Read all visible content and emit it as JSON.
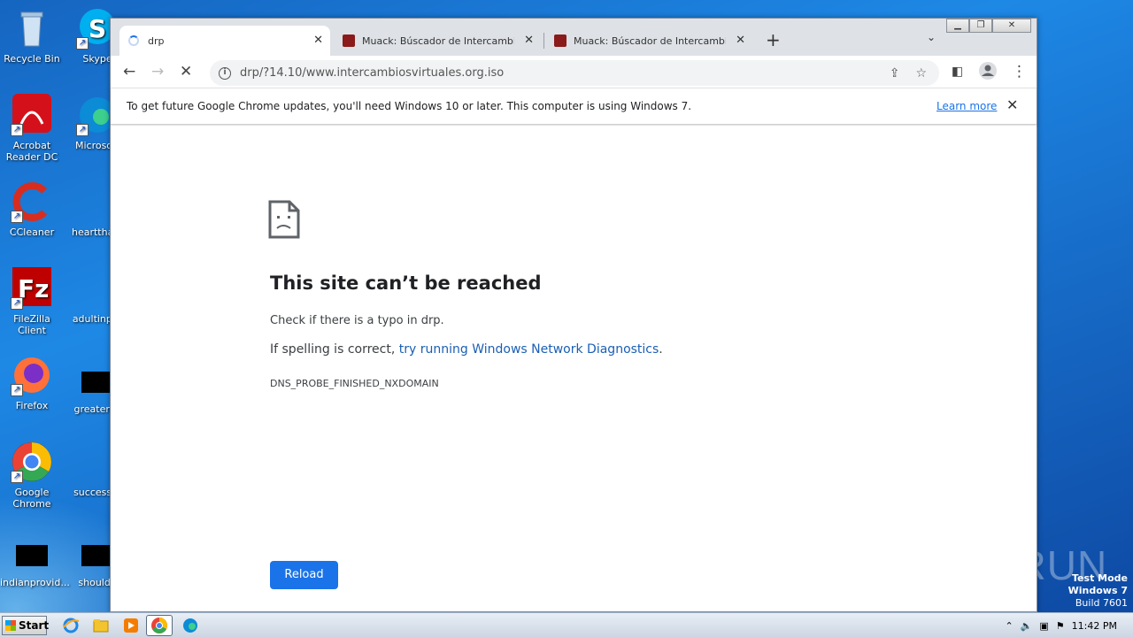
{
  "desktop": {
    "icons_col1": [
      {
        "label": "Recycle Bin",
        "icon": "recycle-bin-icon"
      },
      {
        "label": "Acrobat Reader DC",
        "icon": "acrobat-icon"
      },
      {
        "label": "CCleaner",
        "icon": "ccleaner-icon"
      },
      {
        "label": "FileZilla Client",
        "icon": "filezilla-icon"
      },
      {
        "label": "Firefox",
        "icon": "firefox-icon"
      },
      {
        "label": "Google Chrome",
        "icon": "chrome-icon"
      },
      {
        "label": "indianprovid...",
        "icon": "file-icon"
      }
    ],
    "icons_col2": [
      {
        "label": "Skype",
        "icon": "skype-icon"
      },
      {
        "label": "Microsoft",
        "icon": "edge-icon"
      },
      {
        "label": "hearttham",
        "icon": "file-icon"
      },
      {
        "label": "adultinput",
        "icon": "file-icon"
      },
      {
        "label": "greaterco",
        "icon": "file-icon"
      },
      {
        "label": "successfu",
        "icon": "file-icon"
      },
      {
        "label": "shoulda",
        "icon": "file-icon"
      }
    ]
  },
  "browser": {
    "tabs": [
      {
        "title": "drp",
        "active": true
      },
      {
        "title": "Muack: Búscador de IntercambiosVirtuales",
        "active": false
      },
      {
        "title": "Muack: Búscador de IntercambiosVirtuales",
        "active": false
      }
    ],
    "url": "drp/?14.10/www.intercambiosvirtuales.org.iso",
    "infobar": {
      "message": "To get future Google Chrome updates, you'll need Windows 10 or later. This computer is using Windows 7.",
      "link": "Learn more"
    },
    "error": {
      "title": "This site can’t be reached",
      "line1": "Check if there is a typo in drp.",
      "line2_prefix": "If spelling is correct, ",
      "line2_link": "try running Windows Network Diagnostics",
      "line2_suffix": ".",
      "code": "DNS_PROBE_FINISHED_NXDOMAIN",
      "reload": "Reload"
    }
  },
  "overlay": {
    "watermark": "ANY RUN",
    "testmode_line1": "Test Mode",
    "testmode_line2": "Windows 7",
    "testmode_line3": "Build 7601"
  },
  "taskbar": {
    "start": "Start",
    "clock": "11:42 PM"
  }
}
